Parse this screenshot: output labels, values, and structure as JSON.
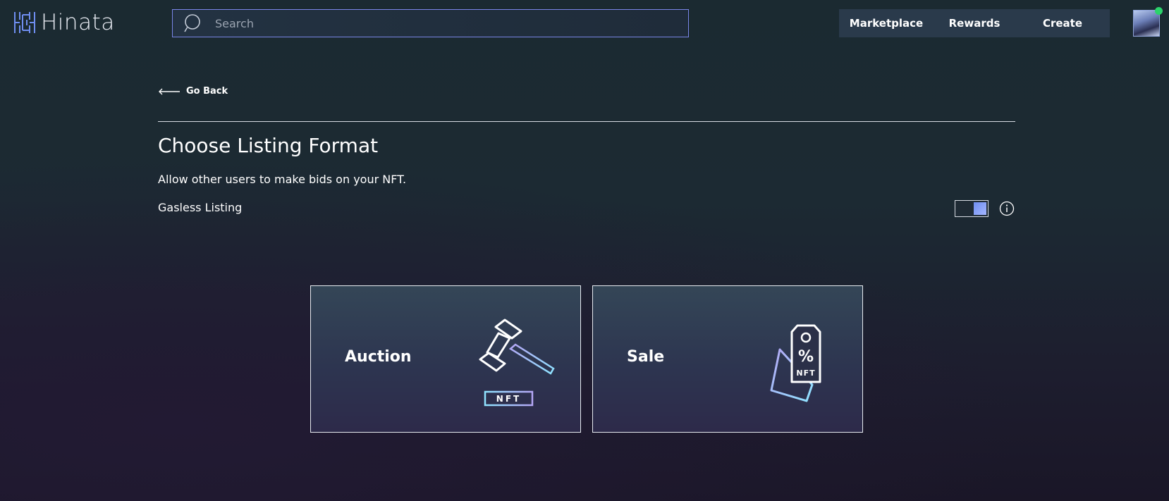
{
  "header": {
    "brand": "Hinata",
    "search_placeholder": "Search",
    "nav": [
      {
        "label": "Marketplace"
      },
      {
        "label": "Rewards"
      },
      {
        "label": "Create"
      }
    ],
    "status_color": "#2bd36b"
  },
  "page": {
    "go_back": "Go Back",
    "title": "Choose Listing Format",
    "subtitle": "Allow other users to make bids on your NFT.",
    "gasless_label": "Gasless Listing",
    "gasless_enabled": true,
    "accent_color": "#7a86e8"
  },
  "formats": [
    {
      "label": "Auction",
      "icon": "gavel-icon",
      "tag": "NFT"
    },
    {
      "label": "Sale",
      "icon": "price-tag-icon",
      "tag": "NFT",
      "symbol": "%"
    }
  ]
}
